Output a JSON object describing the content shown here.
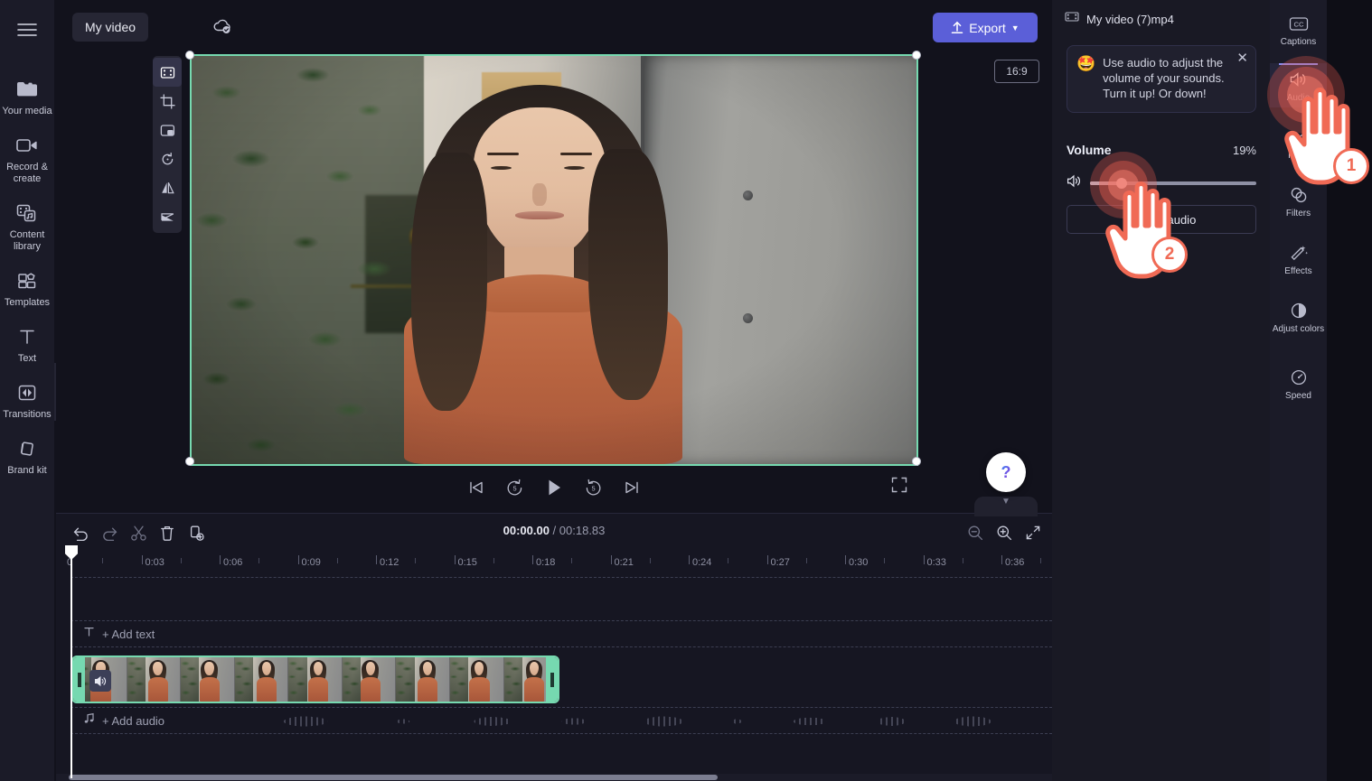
{
  "app": {
    "project_name": "My video",
    "export_label": "Export",
    "aspect_ratio": "16:9"
  },
  "left_rail": {
    "menu_icon": "hamburger-menu-icon",
    "items": [
      {
        "label": "Your media",
        "icon": "folder-icon"
      },
      {
        "label": "Record & create",
        "icon": "video-camera-icon"
      },
      {
        "label": "Content library",
        "icon": "content-library-icon"
      },
      {
        "label": "Templates",
        "icon": "templates-icon"
      },
      {
        "label": "Text",
        "icon": "text-icon"
      },
      {
        "label": "Transitions",
        "icon": "transitions-icon"
      },
      {
        "label": "Brand kit",
        "icon": "brand-kit-icon"
      }
    ]
  },
  "edit_toolbar": {
    "items": [
      {
        "icon": "fit-to-frame-icon",
        "selected": true
      },
      {
        "icon": "crop-icon",
        "selected": false
      },
      {
        "icon": "picture-in-picture-icon",
        "selected": false
      },
      {
        "icon": "rotate-icon",
        "selected": false
      },
      {
        "icon": "flip-horizontal-icon",
        "selected": false
      },
      {
        "icon": "flip-vertical-icon",
        "selected": false
      }
    ]
  },
  "playback": {
    "skip_start": "skip-to-start-icon",
    "rewind": "rewind-5-icon",
    "play": "play-icon",
    "forward": "forward-5-icon",
    "skip_end": "skip-to-end-icon",
    "fullscreen": "fullscreen-icon"
  },
  "timeline": {
    "current_time": "00:00.00",
    "separator": " / ",
    "total_time": "00:18.83",
    "tools": [
      {
        "name": "undo",
        "icon": "undo-icon"
      },
      {
        "name": "redo",
        "icon": "redo-icon"
      },
      {
        "name": "split",
        "icon": "scissors-icon"
      },
      {
        "name": "delete",
        "icon": "trash-icon"
      },
      {
        "name": "duplicate",
        "icon": "duplicate-icon"
      }
    ],
    "zoom_out": "zoom-out-icon",
    "zoom_in": "zoom-in-icon",
    "fit": "fit-timeline-icon",
    "ruler_labels": [
      "0",
      "0:03",
      "0:06",
      "0:09",
      "0:12",
      "0:15",
      "0:18",
      "0:21",
      "0:24",
      "0:27",
      "0:30",
      "0:33",
      "0:36"
    ],
    "add_text_label": "+ Add text",
    "add_audio_label": "+ Add audio",
    "clip_accent_color": "#76d9b0"
  },
  "properties": {
    "file_name": "My video (7)mp4",
    "file_icon": "film-strip-icon",
    "tip": {
      "emoji": "🤩",
      "text": "Use audio to adjust the volume of your sounds. Turn it up! Or down!",
      "close_icon": "close-icon"
    },
    "volume": {
      "label": "Volume",
      "value_text": "19%",
      "value_pct": 19,
      "speaker_icon": "speaker-icon"
    },
    "detach_audio_label": "Detach audio"
  },
  "right_rail": {
    "tabs": [
      {
        "label": "Captions",
        "icon": "captions-icon",
        "active": false
      },
      {
        "label": "Audio",
        "icon": "audio-icon",
        "active": true
      },
      {
        "label": "Fade",
        "icon": "fade-icon",
        "active": false
      },
      {
        "label": "Filters",
        "icon": "filters-icon",
        "active": false
      },
      {
        "label": "Effects",
        "icon": "effects-icon",
        "active": false
      },
      {
        "label": "Adjust colors",
        "icon": "adjust-colors-icon",
        "active": false
      },
      {
        "label": "Speed",
        "icon": "speed-icon",
        "active": false
      }
    ]
  },
  "annotations": {
    "accent_color": "#f06a55",
    "steps": [
      {
        "number": "1",
        "target": "audio-tab"
      },
      {
        "number": "2",
        "target": "volume-slider"
      }
    ]
  },
  "help": {
    "icon": "question-mark-icon",
    "collapse_icon": "chevron-down-icon"
  }
}
